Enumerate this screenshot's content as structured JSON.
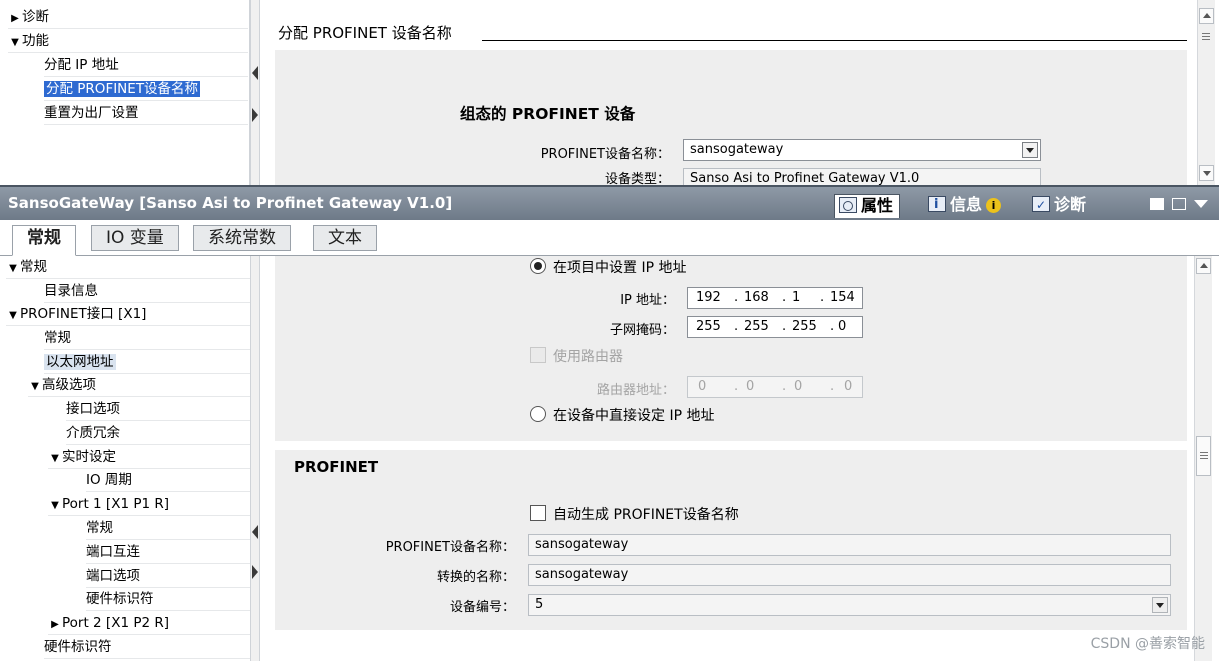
{
  "top": {
    "tree": {
      "items": [
        {
          "label": "诊断",
          "expanded": false
        },
        {
          "label": "功能",
          "expanded": true
        },
        {
          "label": "分配 IP 地址"
        },
        {
          "label": "分配 PROFINET设备名称",
          "selected": true
        },
        {
          "label": "重置为出厂设置"
        }
      ]
    },
    "section_title": "分配 PROFINET 设备名称",
    "configured_heading": "组态的 PROFINET 设备",
    "device_name_label": "PROFINET设备名称：",
    "device_name_value": "sansogateway",
    "device_type_label": "设备类型：",
    "device_type_value": "Sanso Asi to Profinet Gateway V1.0"
  },
  "inspector": {
    "title": "SansoGateWay [Sanso Asi to Profinet Gateway V1.0]",
    "tabs": {
      "properties": "属性",
      "info": "信息",
      "info_badge": "i",
      "diagnostics": "诊断"
    },
    "subtabs": [
      "常规",
      "IO 变量",
      "系统常数",
      "文本"
    ]
  },
  "bottom": {
    "tree": {
      "items": [
        {
          "label": "常规",
          "expanded": true
        },
        {
          "label": "目录信息"
        },
        {
          "label": "PROFINET接口 [X1]",
          "expanded": true
        },
        {
          "label": "常规"
        },
        {
          "label": "以太网地址",
          "highlighted": true
        },
        {
          "label": "高级选项",
          "expanded": true
        },
        {
          "label": "接口选项"
        },
        {
          "label": "介质冗余"
        },
        {
          "label": "实时设定",
          "expanded": true
        },
        {
          "label": "IO 周期"
        },
        {
          "label": "Port 1 [X1 P1 R]",
          "expanded": true
        },
        {
          "label": "常规"
        },
        {
          "label": "端口互连"
        },
        {
          "label": "端口选项"
        },
        {
          "label": "硬件标识符"
        },
        {
          "label": "Port 2 [X1 P2 R]",
          "expanded": false
        },
        {
          "label": "硬件标识符"
        }
      ]
    },
    "ip": {
      "radio_set_in_project": "在项目中设置 IP 地址",
      "radio_set_in_project_selected": true,
      "ip_label": "IP 地址：",
      "ip_octets": [
        "192",
        "168",
        "1",
        "154"
      ],
      "subnet_label": "子网掩码：",
      "subnet_octets": [
        "255",
        "255",
        "255",
        "0"
      ],
      "use_router_label": "使用路由器",
      "use_router_checked": false,
      "router_label": "路由器地址：",
      "router_octets": [
        "0",
        "0",
        "0",
        "0"
      ],
      "radio_set_on_device": "在设备中直接设定 IP 地址"
    },
    "profinet": {
      "heading": "PROFINET",
      "auto_generate_label": "自动生成 PROFINET设备名称",
      "auto_generate_checked": false,
      "device_name_label": "PROFINET设备名称：",
      "device_name_value": "sansogateway",
      "converted_name_label": "转换的名称：",
      "converted_name_value": "sansogateway",
      "device_number_label": "设备编号：",
      "device_number_value": "5"
    }
  },
  "watermark": "CSDN @善索智能"
}
